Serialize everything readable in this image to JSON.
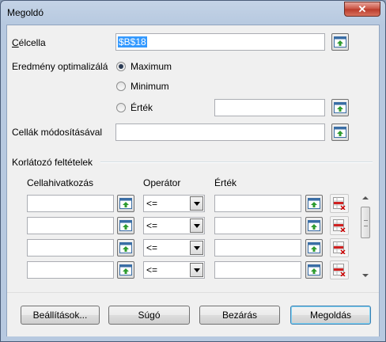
{
  "window": {
    "title": "Megoldó",
    "close_label": "✕"
  },
  "target_cell": {
    "label": "Célcella",
    "value": "$B$18"
  },
  "optimize": {
    "label": "Eredmény optimalizálá",
    "options": [
      "Maximum",
      "Minimum",
      "Érték"
    ],
    "selected": "Maximum",
    "value_field": ""
  },
  "changing_cells": {
    "label": "Cellák módosításával",
    "value": ""
  },
  "constraints": {
    "section_label": "Korlátozó feltételek",
    "col_cell_ref": "Cellahivatkozás",
    "col_operator": "Operátor",
    "col_value": "Érték",
    "rows": [
      {
        "cell_ref": "",
        "operator": "<=",
        "value": ""
      },
      {
        "cell_ref": "",
        "operator": "<=",
        "value": ""
      },
      {
        "cell_ref": "",
        "operator": "<=",
        "value": ""
      },
      {
        "cell_ref": "",
        "operator": "<=",
        "value": ""
      }
    ]
  },
  "buttons": {
    "options": "Beállítások...",
    "help": "Súgó",
    "close": "Bezárás",
    "solve": "Megoldás"
  },
  "icons": {
    "shrink": "shrink-icon",
    "delete": "delete-row-icon"
  }
}
